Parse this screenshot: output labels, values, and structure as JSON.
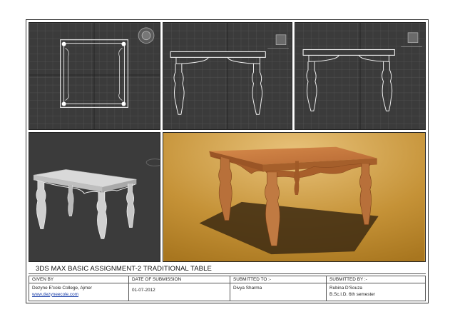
{
  "sheet": {
    "title": "3DS MAX BASIC ASSIGNMENT-2 TRADITIONAL TABLE"
  },
  "viewports": [
    {
      "name": "top"
    },
    {
      "name": "front"
    },
    {
      "name": "left"
    },
    {
      "name": "perspective"
    },
    {
      "name": "render"
    }
  ],
  "info": {
    "given_by": {
      "header": "GIVEN BY",
      "line1": "Dezyne E'cole College, Ajmer",
      "line2": "www.dezyneecole.com"
    },
    "date": {
      "header": "DATE OF SUBMISSION",
      "value": "01-07-2012"
    },
    "submitted_to": {
      "header": "SUBMITTED TO :-",
      "value": "Divya Sharma"
    },
    "submitted_by": {
      "header": "SUBMITTED BY :-",
      "line1": "Rubina D'Souza",
      "line2": "B.Sc.I.D. 6th semester"
    }
  },
  "colors": {
    "viewport_bg": "#3b3b3b",
    "grid": "#555555",
    "wire": "#f2f2f2",
    "render_bg": "#c99a3f",
    "table_wood": "#b86a35"
  }
}
